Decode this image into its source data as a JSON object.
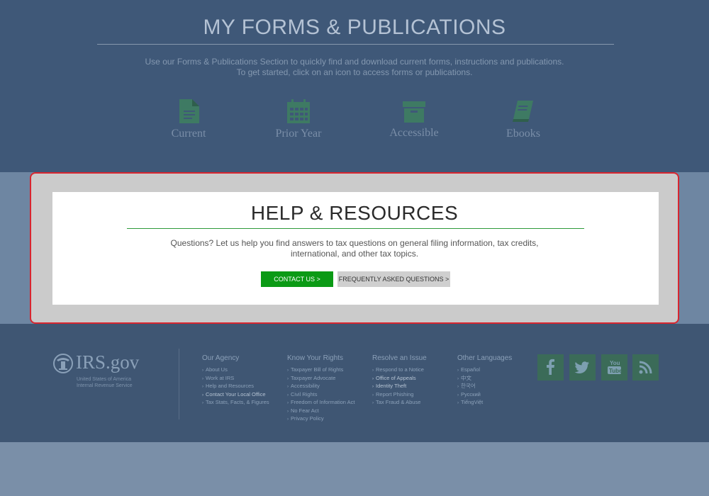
{
  "forms": {
    "title": "MY FORMS & PUBLICATIONS",
    "desc_line1": "Use our Forms & Publications Section to quickly find and download current forms, instructions and publications.",
    "desc_line2": "To get started,  click on an icon to access forms or publications.",
    "tiles": [
      {
        "label": "Current",
        "icon": "document-icon"
      },
      {
        "label": "Prior Year",
        "icon": "calendar-icon"
      },
      {
        "label": "Accessible",
        "icon": "archive-box-icon"
      },
      {
        "label": "Ebooks",
        "icon": "book-icon"
      }
    ]
  },
  "help": {
    "title": "HELP & RESOURCES",
    "desc_line1": "Questions? Let us help you find answers to tax questions on general filing information, tax credits,",
    "desc_line2": "international, and other tax topics.",
    "contact_label": "CONTACT US >",
    "faq_label": "FREQUENTLY ASKED QUESTIONS >"
  },
  "footer": {
    "logo_text": "IRS.gov",
    "logo_sub1": "United States of America",
    "logo_sub2": "Internal Revenue Service",
    "columns": [
      {
        "heading": "Our Agency",
        "links": [
          "About Us",
          "Work at IRS",
          "Help and Resources",
          "Contact Your Local Office",
          "Tax Stats, Facts, & Figures"
        ]
      },
      {
        "heading": "Know Your Rights",
        "links": [
          "Taxpayer Bill of Rights",
          "Taxpayer Advocate",
          "Accessibility",
          "Civil Rights",
          "Freedom of Information Act",
          "No Fear Act",
          "Privacy Policy"
        ]
      },
      {
        "heading": "Resolve an Issue",
        "links": [
          "Respond to a Notice",
          "Office of Appeals",
          "Identity Theft",
          "Report Phishing",
          "Tax Fraud & Abuse"
        ]
      },
      {
        "heading": "Other Languages",
        "links": [
          "Español",
          "中文",
          "한국어",
          "Русский",
          "TiếngViệt"
        ]
      }
    ],
    "social": [
      "facebook-icon",
      "twitter-icon",
      "youtube-icon",
      "rss-icon"
    ]
  },
  "colors": {
    "forms_bg": "#3f5878",
    "help_highlight": "#d8262f",
    "contact_green": "#0b9a15",
    "footer_bg": "#3f5673",
    "icon_green": "#3b6b58"
  }
}
